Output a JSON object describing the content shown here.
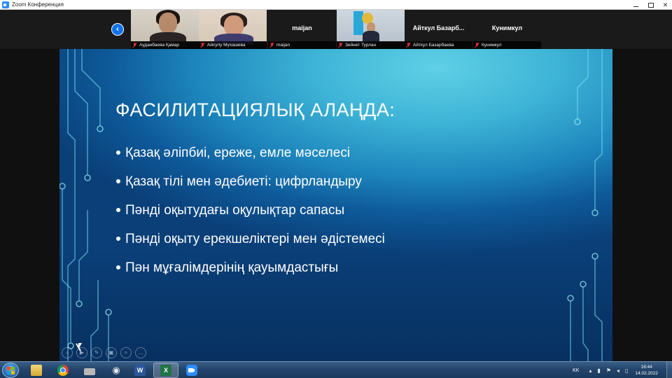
{
  "window": {
    "title": "Zoom Конференция",
    "controls": {
      "minimize": "",
      "maximize": "",
      "close": "✕"
    }
  },
  "video_strip": {
    "prev_button": "‹",
    "participants": [
      {
        "caption": "Ауданбаева Қамар",
        "center_name": "",
        "video": true
      },
      {
        "caption": "Айсулу Мухашева",
        "center_name": "",
        "video": true
      },
      {
        "caption": "maijan",
        "center_name": "maijan",
        "video": false
      },
      {
        "caption": "Зейнет Турлан",
        "center_name": "",
        "video": true
      },
      {
        "caption": "Айткул Базарбаева",
        "center_name": "Айткул  Базарб...",
        "video": false
      },
      {
        "caption": "Кунимкул",
        "center_name": "Кунимкул",
        "video": false
      }
    ]
  },
  "slide": {
    "title": "ФАСИЛИТАЦИЯЛЫҚ АЛАҢДА:",
    "bullets": [
      "Қазақ әліпбиі, ереже, емле мәселесі",
      "Қазақ тілі мен әдебиеті: цифрландыру",
      "Пәнді оқытудағы оқулықтар сапасы",
      "Пәнді оқыту ерекшеліктері мен әдістемесі",
      "Пән мұғалімдерінің қауымдастығы"
    ],
    "tools": [
      "‹",
      "▶",
      "✎",
      "▣",
      "⌕",
      "…"
    ]
  },
  "taskbar": {
    "apps": [
      {
        "name": "file-explorer",
        "label": ""
      },
      {
        "name": "chrome",
        "label": ""
      },
      {
        "name": "scanner",
        "label": ""
      },
      {
        "name": "viewer",
        "label": "◉"
      },
      {
        "name": "word",
        "label": "W"
      },
      {
        "name": "excel",
        "label": "X"
      },
      {
        "name": "zoom",
        "label": ""
      }
    ],
    "tray": {
      "language": "KK",
      "chevron": "▴",
      "clock_time": "16:44",
      "clock_date": "14.02.2022"
    }
  }
}
